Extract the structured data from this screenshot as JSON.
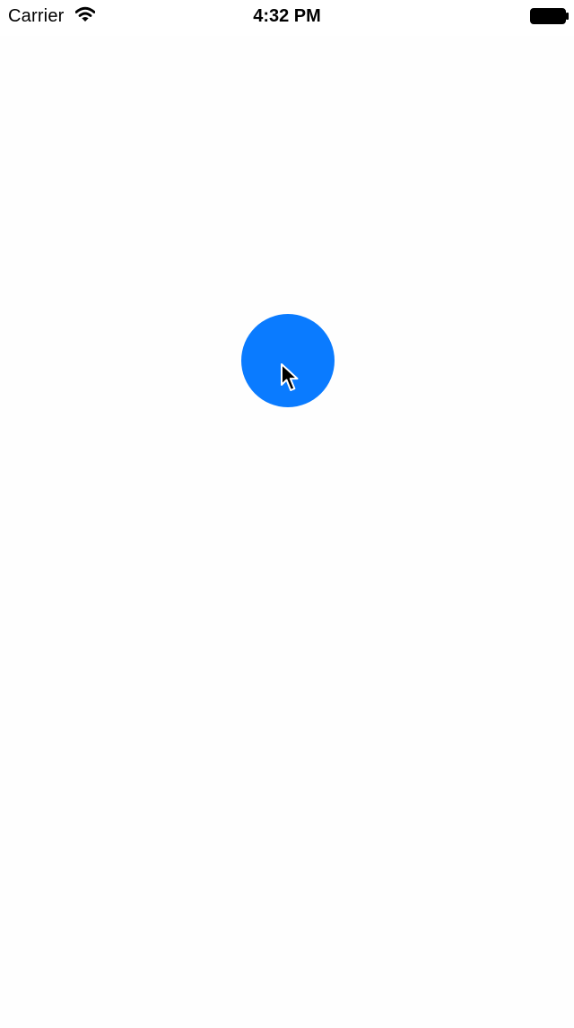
{
  "status_bar": {
    "carrier": "Carrier",
    "time": "4:32 PM",
    "icons": {
      "wifi": "wifi-icon",
      "battery": "battery-icon"
    }
  },
  "colors": {
    "background": "#ffffff",
    "accent_circle": "#0a7bff",
    "text": "#000000"
  },
  "main": {
    "circle_control": "circle-button",
    "cursor_icon": "mouse-pointer-icon"
  }
}
